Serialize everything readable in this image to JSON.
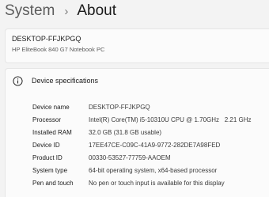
{
  "breadcrumb": {
    "parent": "System",
    "separator": "›",
    "current": "About"
  },
  "device": {
    "name": "DESKTOP-FFJKPGQ",
    "model": "HP EliteBook 840 G7 Notebook PC"
  },
  "specs": {
    "title": "Device specifications",
    "icon": "info-icon",
    "rows": [
      {
        "label": "Device name",
        "value": "DESKTOP-FFJKPGQ"
      },
      {
        "label": "Processor",
        "value": "Intel(R) Core(TM) i5-10310U CPU @ 1.70GHz   2.21 GHz"
      },
      {
        "label": "Installed RAM",
        "value": "32.0 GB (31.8 GB usable)"
      },
      {
        "label": "Device ID",
        "value": "17EE47CE-C09C-41A9-9772-282DE7A98FED"
      },
      {
        "label": "Product ID",
        "value": "00330-53527-77759-AAOEM"
      },
      {
        "label": "System type",
        "value": "64-bit operating system, x64-based processor"
      },
      {
        "label": "Pen and touch",
        "value": "No pen or touch input is available for this display"
      }
    ]
  }
}
